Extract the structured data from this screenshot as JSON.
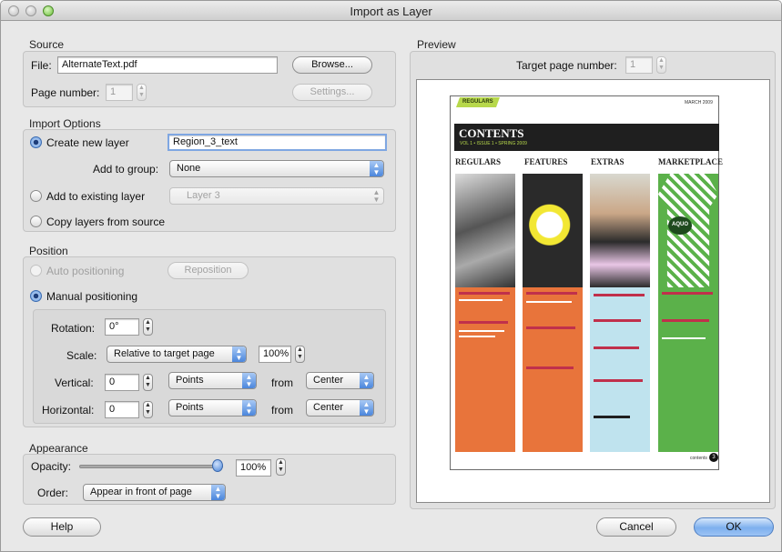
{
  "window": {
    "title": "Import as Layer"
  },
  "source": {
    "heading": "Source",
    "file_label": "File:",
    "file_value": "AlternateText.pdf",
    "browse_label": "Browse...",
    "page_number_label": "Page number:",
    "page_number_value": "1",
    "settings_label": "Settings..."
  },
  "import_options": {
    "heading": "Import Options",
    "create_new_layer": "Create new layer",
    "new_layer_name": "Region_3_text",
    "add_to_group_label": "Add to group:",
    "add_to_group_value": "None",
    "add_to_existing": "Add to existing layer",
    "existing_layer_value": "Layer 3",
    "copy_layers": "Copy layers from source"
  },
  "position": {
    "heading": "Position",
    "auto_positioning": "Auto positioning",
    "reposition_label": "Reposition",
    "manual_positioning": "Manual positioning",
    "rotation_label": "Rotation:",
    "rotation_value": "0°",
    "scale_label": "Scale:",
    "scale_mode": "Relative to target page",
    "scale_value": "100%",
    "vertical_label": "Vertical:",
    "vertical_value": "0",
    "vertical_unit": "Points",
    "vertical_from_label": "from",
    "vertical_from": "Center",
    "horizontal_label": "Horizontal:",
    "horizontal_value": "0",
    "horizontal_unit": "Points",
    "horizontal_from_label": "from",
    "horizontal_from": "Center"
  },
  "appearance": {
    "heading": "Appearance",
    "opacity_label": "Opacity:",
    "opacity_value": "100%",
    "opacity_fraction": 1.0,
    "order_label": "Order:",
    "order_value": "Appear in front of page"
  },
  "preview": {
    "heading": "Preview",
    "target_page_label": "Target page number:",
    "target_page_value": "1",
    "doc": {
      "tab": "REGULARS",
      "header_right": "MARCH 2009",
      "title": "CONTENTS",
      "subtitle": "VOL 1 • ISSUE 1 • SPRING 2009",
      "columns": [
        "REGULARS",
        "FEATURES",
        "EXTRAS",
        "MARKETPLACE"
      ],
      "badge": "AQUO",
      "page_num": "3",
      "footer": "contents"
    }
  },
  "buttons": {
    "help": "Help",
    "cancel": "Cancel",
    "ok": "OK"
  },
  "colors": {
    "accent_blue": "#6fa3ea",
    "orange": "#e8743b",
    "green": "#5bb14a",
    "light_blue": "#bfe3ee",
    "lime": "#b7d84b"
  },
  "icons": {
    "radio": "radio-button",
    "stepper": "up-down-stepper",
    "popup": "popup-arrows"
  }
}
